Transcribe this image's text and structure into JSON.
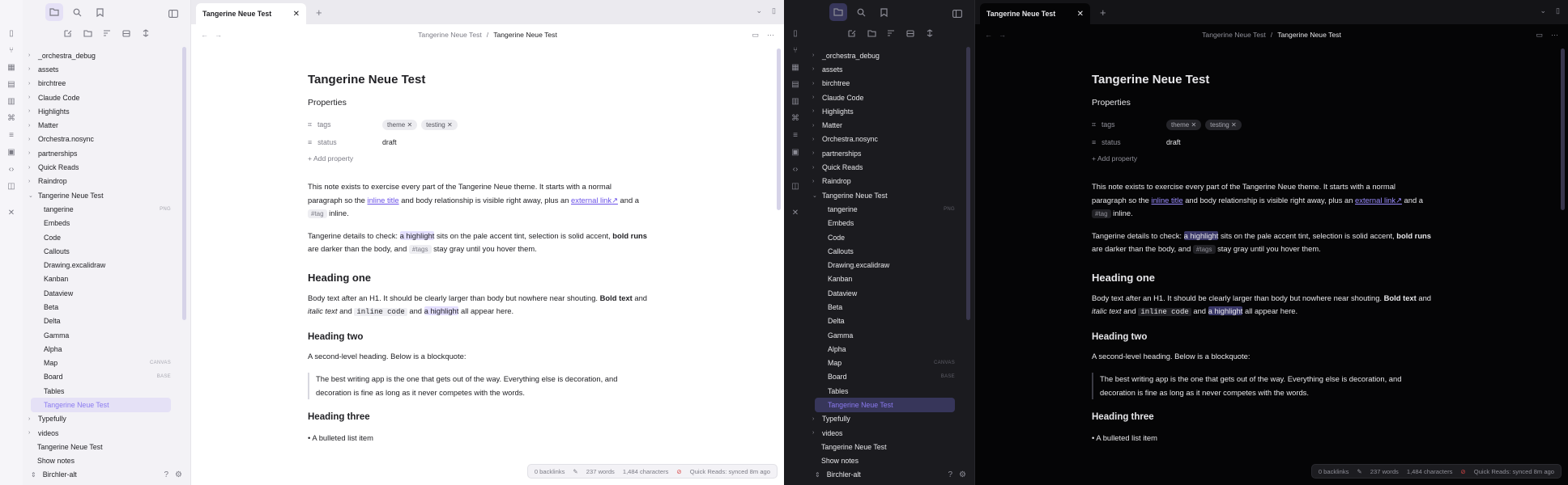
{
  "tab": {
    "title": "Tangerine Neue Test"
  },
  "breadcrumb": {
    "parent": "Tangerine Neue Test",
    "separator": "/",
    "current": "Tangerine Neue Test"
  },
  "tree": [
    {
      "kind": "folder",
      "label": "_orchestra_debug",
      "open": false
    },
    {
      "kind": "folder",
      "label": "assets",
      "open": false
    },
    {
      "kind": "folder",
      "label": "birchtree",
      "open": false
    },
    {
      "kind": "folder",
      "label": "Claude Code",
      "open": false
    },
    {
      "kind": "folder",
      "label": "Highlights",
      "open": false
    },
    {
      "kind": "folder",
      "label": "Matter",
      "open": false
    },
    {
      "kind": "folder",
      "label": "Orchestra.nosync",
      "open": false
    },
    {
      "kind": "folder",
      "label": "partnerships",
      "open": false
    },
    {
      "kind": "folder",
      "label": "Quick Reads",
      "open": false
    },
    {
      "kind": "folder",
      "label": "Raindrop",
      "open": false
    },
    {
      "kind": "folder",
      "label": "Tangerine Neue Test",
      "open": true
    },
    {
      "kind": "file",
      "label": "tangerine",
      "ext": "PNG"
    },
    {
      "kind": "file",
      "label": "Embeds",
      "ext": ""
    },
    {
      "kind": "file",
      "label": "Code",
      "ext": ""
    },
    {
      "kind": "file",
      "label": "Callouts",
      "ext": ""
    },
    {
      "kind": "file",
      "label": "Drawing.excalidraw",
      "ext": ""
    },
    {
      "kind": "file",
      "label": "Kanban",
      "ext": ""
    },
    {
      "kind": "file",
      "label": "Dataview",
      "ext": ""
    },
    {
      "kind": "file",
      "label": "Beta",
      "ext": ""
    },
    {
      "kind": "file",
      "label": "Delta",
      "ext": ""
    },
    {
      "kind": "file",
      "label": "Gamma",
      "ext": ""
    },
    {
      "kind": "file",
      "label": "Alpha",
      "ext": ""
    },
    {
      "kind": "file",
      "label": "Map",
      "ext": "CANVAS"
    },
    {
      "kind": "file",
      "label": "Board",
      "ext": "BASE"
    },
    {
      "kind": "file",
      "label": "Tables",
      "ext": ""
    },
    {
      "kind": "file",
      "label": "Tangerine Neue Test",
      "ext": "",
      "selected": true
    },
    {
      "kind": "folder",
      "label": "Typefully",
      "open": false
    },
    {
      "kind": "folder",
      "label": "videos",
      "open": false
    },
    {
      "kind": "plain",
      "label": "Tangerine Neue Test"
    },
    {
      "kind": "plain",
      "label": "Show notes"
    }
  ],
  "vault": {
    "name": "Birchler-alt"
  },
  "note": {
    "title": "Tangerine Neue Test",
    "properties_heading": "Properties",
    "tags_key": "tags",
    "tags": [
      "theme",
      "testing"
    ],
    "status_key": "status",
    "status_value": "draft",
    "add_property": "Add property",
    "p1a": "This note exists to exercise every part of the Tangerine Neue theme. It starts with a normal paragraph so the ",
    "p1_link1": "inline title",
    "p1b": " and body relationship is visible right away, plus an ",
    "p1_link2": "external link",
    "p1c": " and a ",
    "p1_tag": "#tag",
    "p1d": " inline.",
    "p2a": "Tangerine details to check: ",
    "p2_hl": "a highlight",
    "p2b": " sits on the pale accent tint, selection is solid accent, ",
    "p2_bold": "bold runs",
    "p2c": " are darker than the body, and ",
    "p2_tag": "#tags",
    "p2d": " stay gray until you hover them.",
    "h1": "Heading one",
    "p3a": "Body text after an H1. It should be clearly larger than body but nowhere near shouting. ",
    "p3_bold": "Bold text",
    "p3b": " and ",
    "p3_italic": "italic text",
    "p3c": " and ",
    "p3_code": "inline code",
    "p3d": " and ",
    "p3_hl": "a highlight",
    "p3e": " all appear here.",
    "h2": "Heading two",
    "p4": "A second-level heading. Below is a blockquote:",
    "quote": "The best writing app is the one that gets out of the way. Everything else is decoration, and decoration is fine as long as it never competes with the words.",
    "h3": "Heading three",
    "li1": "A bulleted list item"
  },
  "status_bar": {
    "backlinks": "0 backlinks",
    "words": "237 words",
    "chars": "1,484 characters",
    "sync": "Quick Reads: synced 8m ago"
  }
}
